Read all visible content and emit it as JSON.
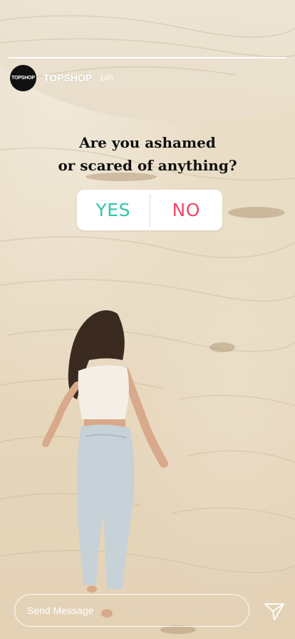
{
  "story": {
    "progress": 1.0,
    "account": {
      "avatar_text": "TOPSHOP",
      "username": "TOPSHOP",
      "timestamp": "14h"
    },
    "question": {
      "line1": "Are you ashamed",
      "line2": "or scared of anything?"
    },
    "poll": {
      "option_yes": "YES",
      "option_no": "NO",
      "yes_color": "#2ec9a7",
      "no_color": "#f3456a"
    }
  },
  "footer": {
    "message_placeholder": "Send Message",
    "send_icon": "paper-plane-icon"
  }
}
